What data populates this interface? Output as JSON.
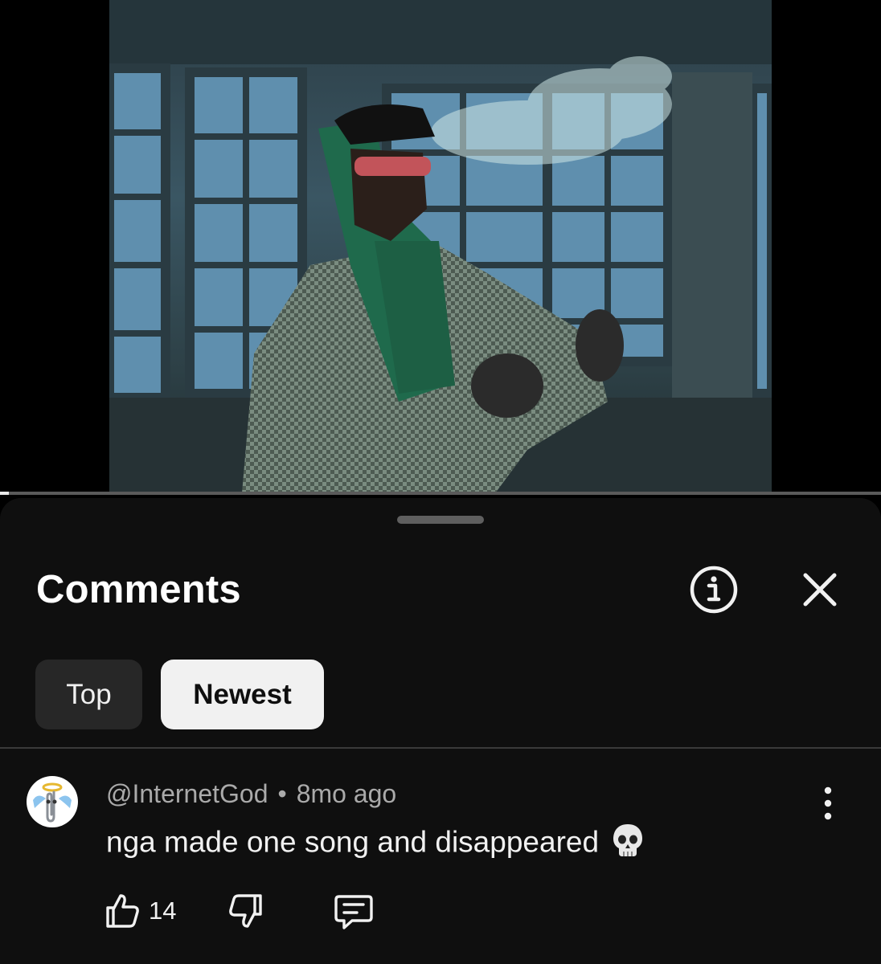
{
  "video": {
    "progress": 0.01
  },
  "comments_panel": {
    "title": "Comments",
    "info_icon": "info-circle-icon",
    "close_icon": "close-icon",
    "filters": [
      {
        "label": "Top",
        "selected": false
      },
      {
        "label": "Newest",
        "selected": true
      }
    ]
  },
  "comment": {
    "author": "@InternetGod",
    "separator": "•",
    "age": "8mo ago",
    "text": "nga made one song and disappeared",
    "emoji_icon": "skull-emoji-icon",
    "likes": "14",
    "actions": [
      "thumbs-up-icon",
      "thumbs-down-icon",
      "reply-icon",
      "more-vertical-icon"
    ]
  },
  "colors": {
    "sheet_bg": "#0f0f0f",
    "chip_default": "#272727",
    "chip_selected": "#f1f1f1",
    "meta_text": "#aaaaaa"
  }
}
